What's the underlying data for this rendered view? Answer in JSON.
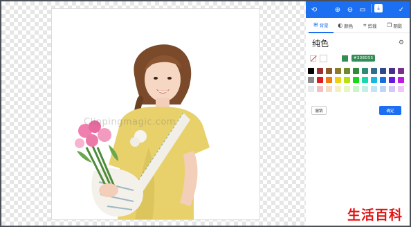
{
  "canvas": {
    "watermark": "Clippingmagic.com"
  },
  "toolbar": {
    "undo_icon": "undo-icon",
    "zoom_in_icon": "zoom-in-icon",
    "zoom_out_icon": "zoom-out-icon",
    "fit_icon": "fit-screen-icon",
    "download_icon": "download-icon",
    "confirm_icon": "check-icon"
  },
  "tabs": [
    {
      "label": "背景",
      "icon": "background-icon",
      "active": true
    },
    {
      "label": "颜色",
      "icon": "color-icon",
      "active": false
    },
    {
      "label": "剪裁",
      "icon": "crop-icon",
      "active": false
    },
    {
      "label": "阴影",
      "icon": "shadow-icon",
      "active": false
    }
  ],
  "section": {
    "title": "纯色"
  },
  "selected": {
    "hex": "#338D55",
    "color": "#338d55"
  },
  "palette": [
    [
      "#000000",
      "#9c2f2f",
      "#8a5a2b",
      "#8a7a2b",
      "#6f8a2b",
      "#2f8a3a",
      "#2f8a76",
      "#2f6f8a",
      "#2f4a8a",
      "#4a2f8a",
      "#7a2f8a"
    ],
    [
      "#8a8a8a",
      "#e01b1b",
      "#f07a10",
      "#f0d010",
      "#b8e010",
      "#18d818",
      "#18d8b0",
      "#18b8e0",
      "#1870e0",
      "#6a18e0",
      "#c018e0"
    ],
    [
      "#e8e8e8",
      "#f3c0c0",
      "#f6dcc0",
      "#f6f0c0",
      "#e8f6c0",
      "#c8f6c8",
      "#c0f0e6",
      "#c0e6f6",
      "#c0d6f6",
      "#d6c8f6",
      "#eec8f6"
    ]
  ],
  "actions": {
    "cancel": "撤销",
    "confirm": "确定"
  },
  "brand": "生活百科"
}
